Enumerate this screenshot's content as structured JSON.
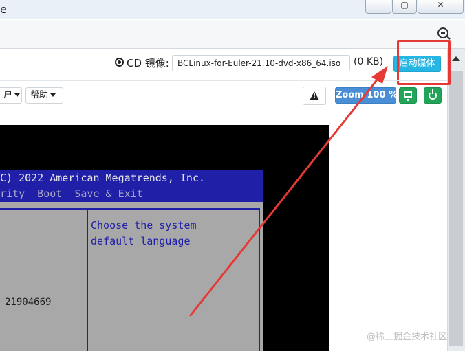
{
  "window": {
    "title_fragment": "e",
    "minimize_glyph": "—",
    "maximize_glyph": "▢",
    "close_glyph": "✕"
  },
  "media": {
    "label": "CD 镜像:",
    "iso_name": "BCLinux-for-Euler-21.10-dvd-x86_64.iso",
    "iso_size": "(0 KB)",
    "launch_button": "启动媒体"
  },
  "menu": {
    "user_label": "户",
    "help_label": "帮助"
  },
  "toolbar": {
    "zoom_label": "Zoom 100 %"
  },
  "console": {
    "copyright_line": "C) 2022 American Megatrends, Inc.",
    "menu_line": "rity  Boot  Save & Exit",
    "help_text": "Choose the system\ndefault language",
    "value_text": "21904669"
  },
  "watermark": "@稀土掘金技术社区",
  "colors": {
    "launch_button": "#25b6e3",
    "zoom_button": "#4a8fd6",
    "green_button": "#23a559",
    "annotation": "#e53935",
    "bios_blue": "#1f1fa8",
    "bios_gray": "#a8a8a8"
  }
}
